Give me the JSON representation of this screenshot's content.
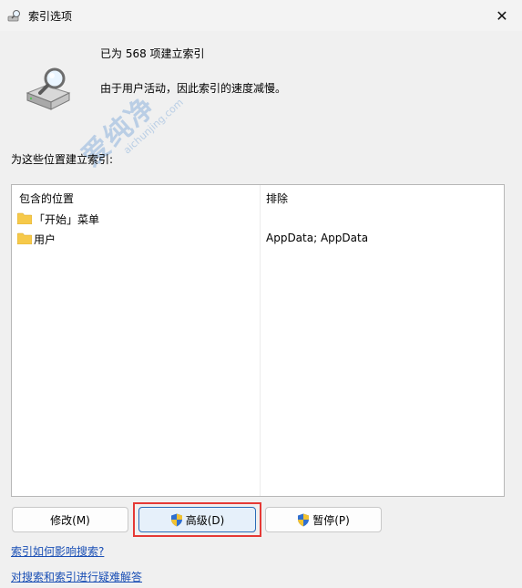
{
  "window": {
    "title": "索引选项",
    "close_glyph": "✕",
    "title_icon": "search-drive-icon"
  },
  "status": {
    "indexed_text": "已为 568 项建立索引",
    "activity_text": "由于用户活动，因此索引的速度减慢。"
  },
  "locations_label": "为这些位置建立索引:",
  "table": {
    "columns": [
      "包含的位置",
      "排除"
    ],
    "rows": [
      {
        "name": "「开始」菜单",
        "exclude": ""
      },
      {
        "name": "用户",
        "exclude": "AppData; AppData"
      }
    ]
  },
  "buttons": {
    "modify": "修改(M)",
    "advanced": "高级(D)",
    "pause": "暂停(P)"
  },
  "links": {
    "how_affects": "索引如何影响搜索?",
    "troubleshoot": "对搜索和索引进行疑难解答"
  },
  "watermark": {
    "main": "爱纯净",
    "sub": "aichunjing.com"
  },
  "colors": {
    "link": "#1a4fb5",
    "highlight": "#e53935",
    "folder": "#f6c94a"
  }
}
